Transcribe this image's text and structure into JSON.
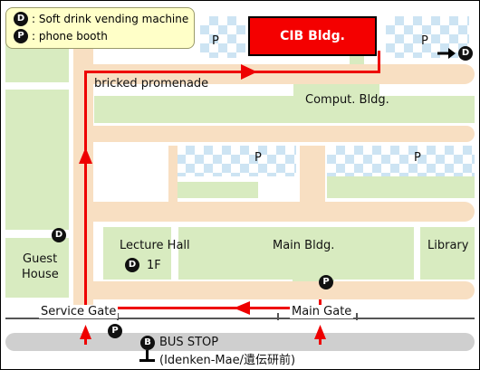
{
  "legend": {
    "items": [
      {
        "icon": "D",
        "label": ": Soft drink vending machine"
      },
      {
        "icon": "P",
        "label": ": phone booth"
      }
    ]
  },
  "buildings": {
    "cib": "CIB Bldg.",
    "comput": "Comput. Bldg.",
    "lecture_hall": "Lecture Hall",
    "lecture_floor": "1F",
    "main": "Main Bldg.",
    "library": "Library",
    "guest_house_line1": "Guest",
    "guest_house_line2": "House"
  },
  "parking_label": "P",
  "promenade_label": "bricked promenade",
  "gates": {
    "service": "Service Gate",
    "main": "Main Gate"
  },
  "bus_stop": {
    "icon": "B",
    "label": "BUS STOP",
    "sublabel": "(Idenken-Mae/遺伝研前)"
  },
  "markers": {
    "vending": "D",
    "phone": "P"
  },
  "colors": {
    "route": "#ee0000",
    "cib_fill": "#f40000",
    "green_space": "#d8ebc0",
    "promenade": "#f8dfc2",
    "parking_checker": "#cde4f3",
    "legend_bg": "#ffffc8",
    "road": "#cfcfcf"
  }
}
